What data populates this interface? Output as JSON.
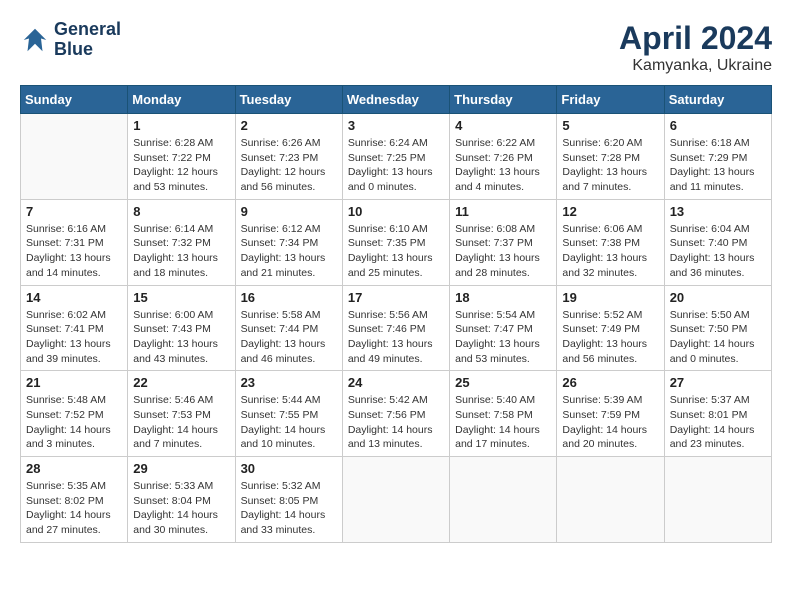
{
  "header": {
    "logo_line1": "General",
    "logo_line2": "Blue",
    "month": "April 2024",
    "location": "Kamyanka, Ukraine"
  },
  "weekdays": [
    "Sunday",
    "Monday",
    "Tuesday",
    "Wednesday",
    "Thursday",
    "Friday",
    "Saturday"
  ],
  "weeks": [
    [
      {
        "day": "",
        "info": ""
      },
      {
        "day": "1",
        "info": "Sunrise: 6:28 AM\nSunset: 7:22 PM\nDaylight: 12 hours\nand 53 minutes."
      },
      {
        "day": "2",
        "info": "Sunrise: 6:26 AM\nSunset: 7:23 PM\nDaylight: 12 hours\nand 56 minutes."
      },
      {
        "day": "3",
        "info": "Sunrise: 6:24 AM\nSunset: 7:25 PM\nDaylight: 13 hours\nand 0 minutes."
      },
      {
        "day": "4",
        "info": "Sunrise: 6:22 AM\nSunset: 7:26 PM\nDaylight: 13 hours\nand 4 minutes."
      },
      {
        "day": "5",
        "info": "Sunrise: 6:20 AM\nSunset: 7:28 PM\nDaylight: 13 hours\nand 7 minutes."
      },
      {
        "day": "6",
        "info": "Sunrise: 6:18 AM\nSunset: 7:29 PM\nDaylight: 13 hours\nand 11 minutes."
      }
    ],
    [
      {
        "day": "7",
        "info": "Sunrise: 6:16 AM\nSunset: 7:31 PM\nDaylight: 13 hours\nand 14 minutes."
      },
      {
        "day": "8",
        "info": "Sunrise: 6:14 AM\nSunset: 7:32 PM\nDaylight: 13 hours\nand 18 minutes."
      },
      {
        "day": "9",
        "info": "Sunrise: 6:12 AM\nSunset: 7:34 PM\nDaylight: 13 hours\nand 21 minutes."
      },
      {
        "day": "10",
        "info": "Sunrise: 6:10 AM\nSunset: 7:35 PM\nDaylight: 13 hours\nand 25 minutes."
      },
      {
        "day": "11",
        "info": "Sunrise: 6:08 AM\nSunset: 7:37 PM\nDaylight: 13 hours\nand 28 minutes."
      },
      {
        "day": "12",
        "info": "Sunrise: 6:06 AM\nSunset: 7:38 PM\nDaylight: 13 hours\nand 32 minutes."
      },
      {
        "day": "13",
        "info": "Sunrise: 6:04 AM\nSunset: 7:40 PM\nDaylight: 13 hours\nand 36 minutes."
      }
    ],
    [
      {
        "day": "14",
        "info": "Sunrise: 6:02 AM\nSunset: 7:41 PM\nDaylight: 13 hours\nand 39 minutes."
      },
      {
        "day": "15",
        "info": "Sunrise: 6:00 AM\nSunset: 7:43 PM\nDaylight: 13 hours\nand 43 minutes."
      },
      {
        "day": "16",
        "info": "Sunrise: 5:58 AM\nSunset: 7:44 PM\nDaylight: 13 hours\nand 46 minutes."
      },
      {
        "day": "17",
        "info": "Sunrise: 5:56 AM\nSunset: 7:46 PM\nDaylight: 13 hours\nand 49 minutes."
      },
      {
        "day": "18",
        "info": "Sunrise: 5:54 AM\nSunset: 7:47 PM\nDaylight: 13 hours\nand 53 minutes."
      },
      {
        "day": "19",
        "info": "Sunrise: 5:52 AM\nSunset: 7:49 PM\nDaylight: 13 hours\nand 56 minutes."
      },
      {
        "day": "20",
        "info": "Sunrise: 5:50 AM\nSunset: 7:50 PM\nDaylight: 14 hours\nand 0 minutes."
      }
    ],
    [
      {
        "day": "21",
        "info": "Sunrise: 5:48 AM\nSunset: 7:52 PM\nDaylight: 14 hours\nand 3 minutes."
      },
      {
        "day": "22",
        "info": "Sunrise: 5:46 AM\nSunset: 7:53 PM\nDaylight: 14 hours\nand 7 minutes."
      },
      {
        "day": "23",
        "info": "Sunrise: 5:44 AM\nSunset: 7:55 PM\nDaylight: 14 hours\nand 10 minutes."
      },
      {
        "day": "24",
        "info": "Sunrise: 5:42 AM\nSunset: 7:56 PM\nDaylight: 14 hours\nand 13 minutes."
      },
      {
        "day": "25",
        "info": "Sunrise: 5:40 AM\nSunset: 7:58 PM\nDaylight: 14 hours\nand 17 minutes."
      },
      {
        "day": "26",
        "info": "Sunrise: 5:39 AM\nSunset: 7:59 PM\nDaylight: 14 hours\nand 20 minutes."
      },
      {
        "day": "27",
        "info": "Sunrise: 5:37 AM\nSunset: 8:01 PM\nDaylight: 14 hours\nand 23 minutes."
      }
    ],
    [
      {
        "day": "28",
        "info": "Sunrise: 5:35 AM\nSunset: 8:02 PM\nDaylight: 14 hours\nand 27 minutes."
      },
      {
        "day": "29",
        "info": "Sunrise: 5:33 AM\nSunset: 8:04 PM\nDaylight: 14 hours\nand 30 minutes."
      },
      {
        "day": "30",
        "info": "Sunrise: 5:32 AM\nSunset: 8:05 PM\nDaylight: 14 hours\nand 33 minutes."
      },
      {
        "day": "",
        "info": ""
      },
      {
        "day": "",
        "info": ""
      },
      {
        "day": "",
        "info": ""
      },
      {
        "day": "",
        "info": ""
      }
    ]
  ]
}
